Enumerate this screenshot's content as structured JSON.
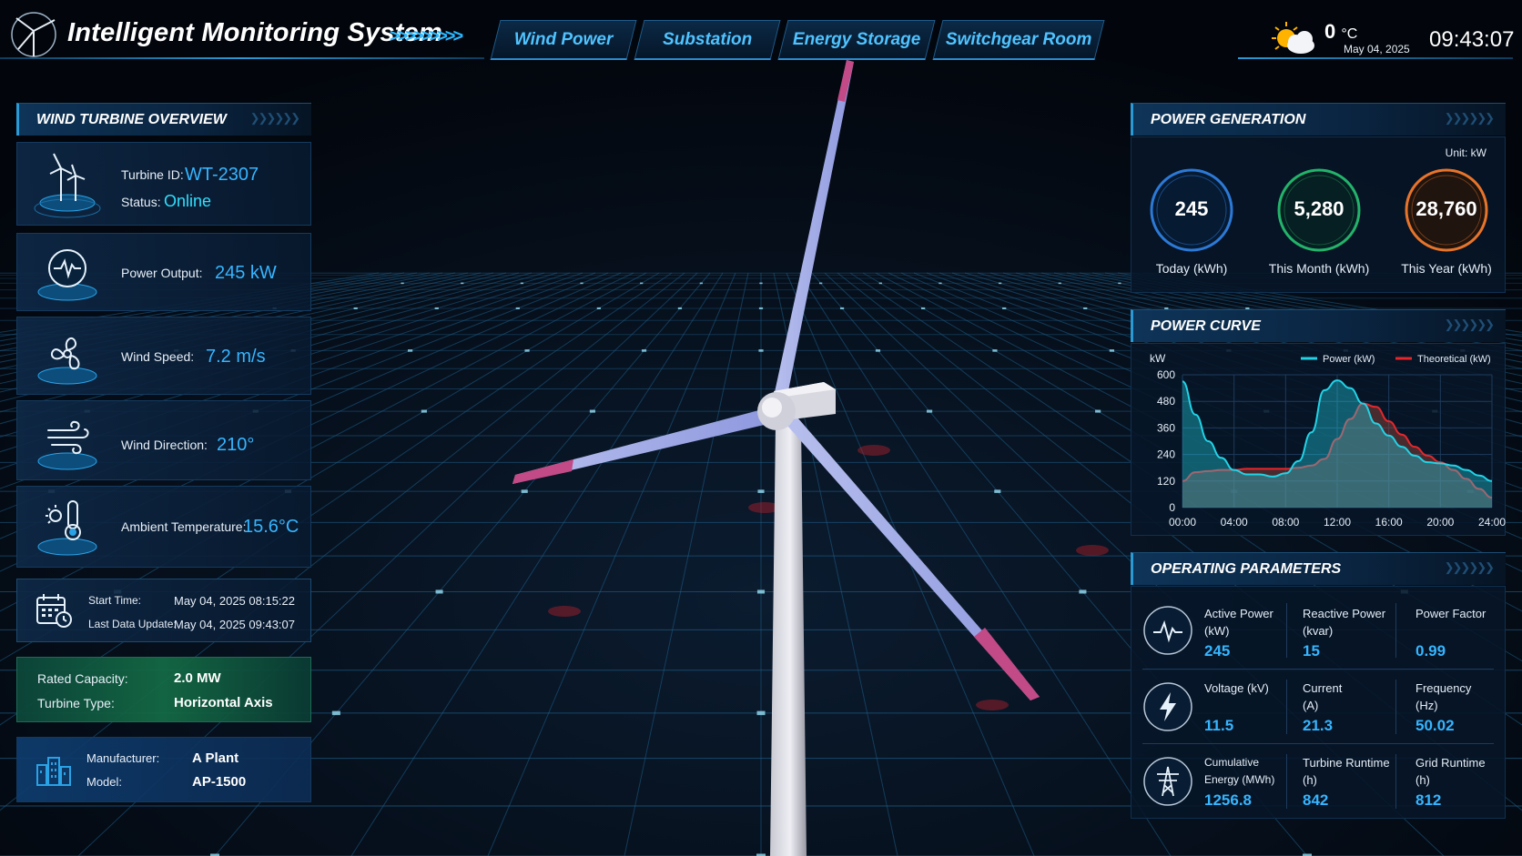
{
  "header": {
    "title": "Intelligent Monitoring System",
    "chevrons": ">>>>>>>>>",
    "tabs": [
      {
        "label": "Wind Power"
      },
      {
        "label": "Substation"
      },
      {
        "label": "Energy Storage"
      },
      {
        "label": "Switchgear Room"
      }
    ],
    "weather": {
      "icon": "partly-sunny-icon",
      "temperature": "0",
      "unit": "°C",
      "date": "May 04, 2025"
    },
    "time": "09:43:07"
  },
  "overview": {
    "title": "WIND TURBINE OVERVIEW",
    "turbine": {
      "id_label": "Turbine ID:",
      "id_value": "WT-2307",
      "status_label": "Status:",
      "status_value": "Online"
    },
    "power_output": {
      "label": "Power Output:",
      "value": "245 kW"
    },
    "wind_speed": {
      "label": "Wind Speed:",
      "value": "7.2 m/s"
    },
    "wind_direction": {
      "label": "Wind Direction:",
      "value": "210°"
    },
    "ambient_temperature": {
      "label": "Ambient Temperature:",
      "value": "15.6°C"
    },
    "times": {
      "start_label": "Start Time:",
      "start_value": "May 04, 2025 08:15:22",
      "update_label": "Last Data Update:",
      "update_value": "May 04, 2025 09:43:07"
    },
    "specs": {
      "capacity_label": "Rated Capacity:",
      "capacity_value": "2.0 MW",
      "type_label": "Turbine Type:",
      "type_value": "Horizontal Axis"
    },
    "maker": {
      "manufacturer_label": "Manufacturer:",
      "manufacturer_value": "A Plant",
      "model_label": "Model:",
      "model_value": "AP-1500"
    }
  },
  "generation": {
    "title": "POWER GENERATION",
    "unit": "Unit: kW",
    "gauges": [
      {
        "value": "245",
        "label": "Today (kWh)",
        "color": "#2f7fe0"
      },
      {
        "value": "5,280",
        "label": "This Month (kWh)",
        "color": "#23b36a"
      },
      {
        "value": "28,760",
        "label": "This Year (kWh)",
        "color": "#e8742a"
      }
    ]
  },
  "power_curve": {
    "title": "POWER CURVE",
    "chart_data": {
      "type": "area",
      "ylabel": "kW",
      "ylim": [
        0,
        600
      ],
      "yticks": [
        "0",
        "120",
        "240",
        "360",
        "480",
        "600"
      ],
      "xticks": [
        "00:00",
        "04:00",
        "08:00",
        "12:00",
        "16:00",
        "20:00",
        "24:00"
      ],
      "x": [
        0,
        1,
        2,
        3,
        4,
        5,
        6,
        7,
        8,
        9,
        10,
        11,
        12,
        13,
        14,
        15,
        16,
        17,
        18,
        19,
        20,
        21,
        22,
        23,
        24
      ],
      "legend_position": "top-right",
      "grid": true,
      "series": [
        {
          "name": "Power (kW)",
          "color": "#22d3e6",
          "values": [
            570,
            420,
            300,
            225,
            170,
            150,
            150,
            140,
            155,
            210,
            340,
            530,
            575,
            540,
            470,
            380,
            325,
            275,
            235,
            205,
            200,
            190,
            170,
            145,
            120
          ]
        },
        {
          "name": "Theoretical (kW)",
          "color": "#e8262a",
          "values": [
            120,
            160,
            165,
            170,
            170,
            175,
            175,
            175,
            175,
            180,
            190,
            220,
            310,
            400,
            470,
            455,
            390,
            330,
            275,
            235,
            205,
            170,
            130,
            85,
            45
          ]
        }
      ]
    }
  },
  "parameters": {
    "title": "OPERATING PARAMETERS",
    "rows": [
      {
        "icon": "pulse-icon",
        "items": [
          {
            "label": "Active Power (kW)",
            "value": "245"
          },
          {
            "label": "Reactive Power (kvar)",
            "value": "15"
          },
          {
            "label": "Power Factor",
            "value": "0.99"
          }
        ]
      },
      {
        "icon": "lightning-icon",
        "items": [
          {
            "label": "Voltage (kV)",
            "value": "11.5"
          },
          {
            "label": "Current (A)",
            "value": "21.3"
          },
          {
            "label": "Frequency (Hz)",
            "value": "50.02"
          }
        ]
      },
      {
        "icon": "transmission-tower-icon",
        "items": [
          {
            "label": "Cumulative Energy (MWh)",
            "value": "1256.8"
          },
          {
            "label": "Turbine Runtime (h)",
            "value": "842"
          },
          {
            "label": "Grid Runtime (h)",
            "value": "812"
          }
        ]
      }
    ]
  }
}
